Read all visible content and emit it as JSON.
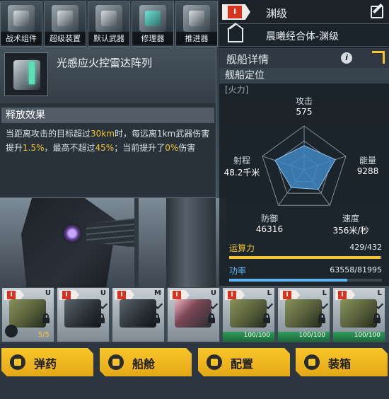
{
  "tabs": [
    {
      "label": "战术组件",
      "icon": "tactical-module-icon"
    },
    {
      "label": "超级装置",
      "icon": "super-device-icon"
    },
    {
      "label": "默认武器",
      "icon": "default-weapon-icon"
    },
    {
      "label": "修理器",
      "icon": "repair-device-icon"
    },
    {
      "label": "推进器",
      "icon": "thruster-icon"
    }
  ],
  "module": {
    "name": "光感应火控雷达阵列",
    "effect_title": "释放效果",
    "effect_text_a": "当距离攻击的目标超过",
    "effect_val1": "30km",
    "effect_text_b": "时，每远离1km武器伤害提升",
    "effect_val2": "1.5%",
    "effect_text_c": "，最高不超过",
    "effect_val3": "45%",
    "effect_text_d": "；当前提升了",
    "effect_val4": "0%",
    "effect_text_e": "伤害"
  },
  "ship": {
    "rank": "I",
    "tier": "渊级",
    "name": "晨曦经合体-渊级",
    "panel_title": "舰船详情",
    "position_title": "舰船定位",
    "position_sub": "[火力]"
  },
  "stats": {
    "attack": {
      "label": "攻击",
      "value": "575"
    },
    "energy": {
      "label": "能量",
      "value": "9288"
    },
    "speed": {
      "label": "速度",
      "value": "356米/秒"
    },
    "defense": {
      "label": "防御",
      "value": "46316"
    },
    "range": {
      "label": "射程",
      "value": "48.2千米"
    }
  },
  "radar_levels": [
    0.55,
    0.75,
    0.55,
    0.5,
    0.7
  ],
  "bars": {
    "compute": {
      "label": "运算力",
      "value": "429/432",
      "fraction": 0.993,
      "color": "#f5c430"
    },
    "power": {
      "label": "功率",
      "value": "63558/81995",
      "fraction": 0.775,
      "color": "#5fb4f0"
    }
  },
  "slots": [
    {
      "size": "U",
      "kind": "olive",
      "count": "5/5",
      "tool": true
    },
    {
      "size": "U",
      "kind": "dark"
    },
    {
      "size": "M",
      "kind": "dark"
    },
    {
      "size": "U",
      "kind": "pink"
    },
    {
      "size": "L",
      "kind": "olive",
      "hp": "100/100"
    },
    {
      "size": "L",
      "kind": "olive",
      "hp": "100/100"
    },
    {
      "size": "L",
      "kind": "olive",
      "hp": "100/100"
    }
  ],
  "buttons": [
    {
      "label": "弹药",
      "icon": "ammo-icon"
    },
    {
      "label": "船舱",
      "icon": "cabin-icon"
    },
    {
      "label": "配置",
      "icon": "config-icon"
    },
    {
      "label": "装箱",
      "icon": "crate-icon"
    }
  ]
}
